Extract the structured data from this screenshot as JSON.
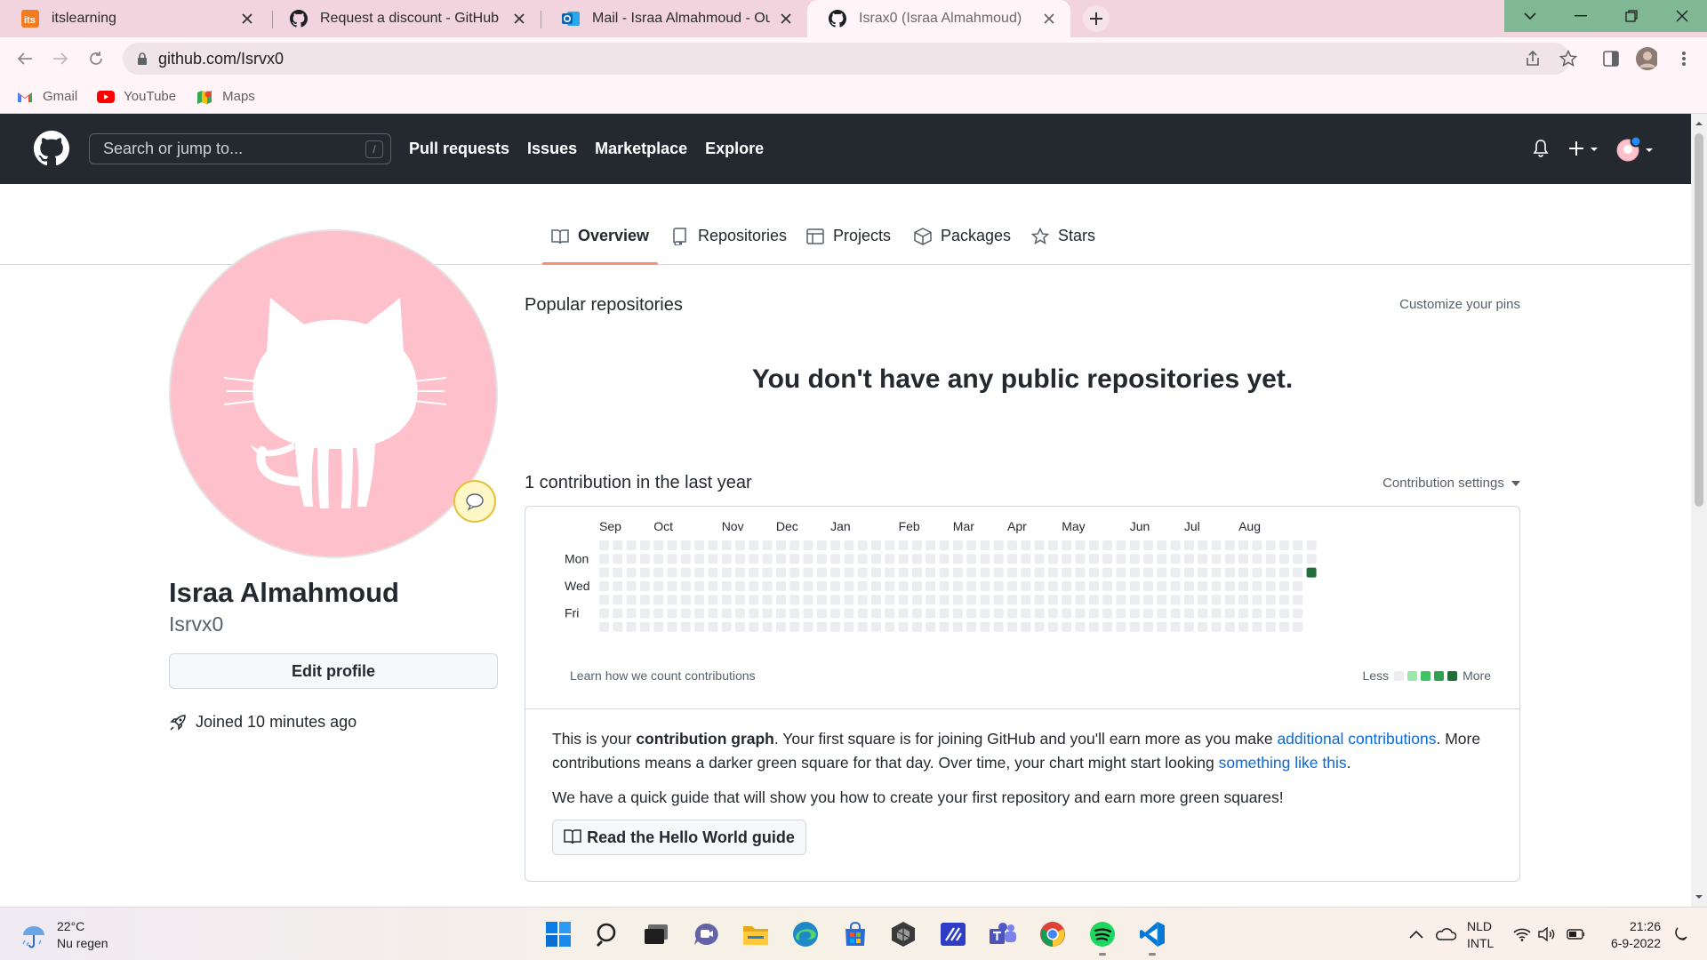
{
  "browser": {
    "tabs": [
      {
        "title": "itslearning",
        "icon": "itslearning-icon",
        "active": false
      },
      {
        "title": "Request a discount - GitHub Edu",
        "icon": "github-icon",
        "active": false
      },
      {
        "title": "Mail - Israa Almahmoud - Outloo",
        "icon": "outlook-icon",
        "active": false
      },
      {
        "title": "Israx0 (Israa Almahmoud)",
        "icon": "github-icon",
        "active": true
      }
    ],
    "url": "github.com/Isrvx0",
    "bookmarks": [
      {
        "label": "Gmail",
        "icon": "gmail-icon"
      },
      {
        "label": "YouTube",
        "icon": "youtube-icon"
      },
      {
        "label": "Maps",
        "icon": "maps-icon"
      }
    ]
  },
  "github_header": {
    "search_placeholder": "Search or jump to...",
    "search_shortcut": "/",
    "nav": [
      "Pull requests",
      "Issues",
      "Marketplace",
      "Explore"
    ]
  },
  "profile_tabs": [
    {
      "label": "Overview",
      "icon": "book-icon",
      "selected": true
    },
    {
      "label": "Repositories",
      "icon": "repo-icon",
      "selected": false
    },
    {
      "label": "Projects",
      "icon": "table-icon",
      "selected": false
    },
    {
      "label": "Packages",
      "icon": "package-icon",
      "selected": false
    },
    {
      "label": "Stars",
      "icon": "star-icon",
      "selected": false
    }
  ],
  "profile": {
    "full_name": "Israa Almahmoud",
    "username": "Isrvx0",
    "edit_profile_label": "Edit profile",
    "joined_text": "Joined 10 minutes ago",
    "avatar_color": "#fec0cb"
  },
  "main": {
    "popular_title": "Popular repositories",
    "customize_pins": "Customize your pins",
    "no_repos_message": "You don't have any public repositories yet.",
    "contrib_title": "1 contribution in the last year",
    "contrib_settings": "Contribution settings",
    "learn_link": "Learn how we count contributions",
    "legend_less": "Less",
    "legend_more": "More",
    "info": {
      "part1": "This is your ",
      "bold": "contribution graph",
      "part2": ". Your first square is for joining GitHub and you'll earn more as you make ",
      "link1": "additional contributions",
      "part3": ". More contributions means a darker green square for that day. Over time, your chart might start looking ",
      "link2": "something like this",
      "part4": "."
    },
    "guide_text": "We have a quick guide that will show you how to create your first repository and earn more green squares!",
    "hello_button": "Read the Hello World guide"
  },
  "contribution_graph": {
    "months": [
      "Sep",
      "Oct",
      "Nov",
      "Dec",
      "Jan",
      "Feb",
      "Mar",
      "Apr",
      "May",
      "Jun",
      "Jul",
      "Aug"
    ],
    "month_start_weeks": [
      0,
      4,
      9,
      13,
      17,
      22,
      26,
      30,
      34,
      39,
      43,
      47
    ],
    "day_labels": [
      {
        "label": "Mon",
        "row": 1
      },
      {
        "label": "Wed",
        "row": 3
      },
      {
        "label": "Fri",
        "row": 5
      }
    ],
    "weeks": 53,
    "last_week_days": 3,
    "contribution": {
      "week": 52,
      "day": 2,
      "level": 4
    },
    "colors": {
      "empty": "#ebedf0",
      "level1": "#9be9a8",
      "level2": "#40c463",
      "level3": "#30a14e",
      "level4": "#216e39"
    }
  },
  "taskbar": {
    "weather_temp": "22°C",
    "weather_desc": "Nu regen",
    "lang_line1": "NLD",
    "lang_line2": "INTL",
    "time": "21:26",
    "date": "6-9-2022",
    "apps": [
      "start-icon",
      "search-icon",
      "task-view-icon",
      "chat-icon",
      "file-explorer-icon",
      "edge-icon",
      "store-icon",
      "unity-icon",
      "code-app-icon",
      "teams-icon",
      "chrome-icon",
      "spotify-icon",
      "vscode-icon"
    ]
  }
}
